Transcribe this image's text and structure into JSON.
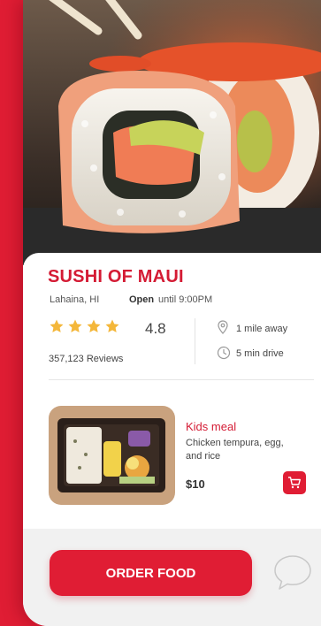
{
  "restaurant": {
    "name": "SUSHI OF MAUI",
    "location": "Lahaina, HI",
    "status_label": "Open",
    "status_time": "until 9:00PM",
    "rating": "4.8",
    "star_count": 4,
    "reviews": "357,123 Reviews",
    "distance": "1 mile away",
    "drive_time": "5 min drive"
  },
  "meal": {
    "title": "Kids meal",
    "description": "Chicken tempura, egg, and rice",
    "price": "$10"
  },
  "actions": {
    "order_label": "ORDER FOOD"
  },
  "colors": {
    "brand_red": "#e01d34",
    "star_gold": "#f4b73a"
  },
  "icons": [
    "location-pin-icon",
    "clock-icon",
    "cart-icon",
    "chat-bubble-icon",
    "star-icon"
  ]
}
